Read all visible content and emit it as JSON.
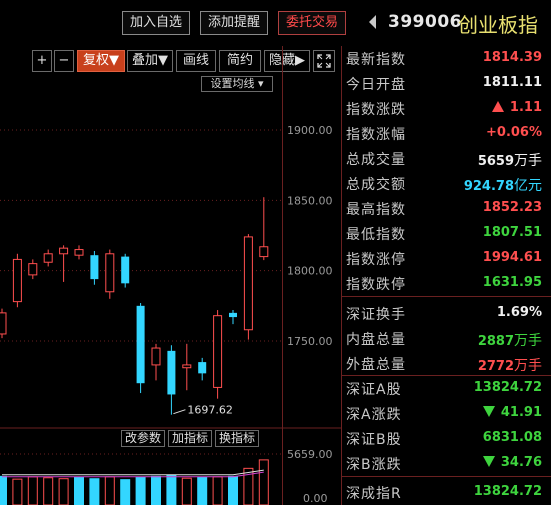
{
  "header": {
    "buttons": [
      "加入自选",
      "添加提醒",
      "委托交易"
    ],
    "code": "399006",
    "name": "创业板指"
  },
  "toolbar": {
    "plus": "+",
    "minus": "−",
    "fuquan": "复权▼",
    "overlay": "叠加▼",
    "draw": "画线",
    "simple": "简约",
    "hide": "隐藏▶",
    "fullscreen_icon": "expand-icon",
    "set_ma": "设置均线 ▾"
  },
  "chart_data": {
    "type": "candlestick",
    "y_ticks": [
      "1900.00",
      "1850.00",
      "1800.00",
      "1750.00"
    ],
    "ylim": [
      1680,
      1945
    ],
    "low_annotation": "1697.62",
    "candles": [
      {
        "o": 1755,
        "c": 1770,
        "h": 1773,
        "l": 1752
      },
      {
        "o": 1778,
        "c": 1808,
        "h": 1812,
        "l": 1774
      },
      {
        "o": 1797,
        "c": 1805,
        "h": 1808,
        "l": 1794
      },
      {
        "o": 1806,
        "c": 1812,
        "h": 1815,
        "l": 1803
      },
      {
        "o": 1812,
        "c": 1816,
        "h": 1818,
        "l": 1792
      },
      {
        "o": 1811,
        "c": 1815,
        "h": 1818,
        "l": 1808
      },
      {
        "o": 1811,
        "c": 1794,
        "h": 1814,
        "l": 1790
      },
      {
        "o": 1785,
        "c": 1812,
        "h": 1815,
        "l": 1780
      },
      {
        "o": 1810,
        "c": 1791,
        "h": 1812,
        "l": 1788
      },
      {
        "o": 1775,
        "c": 1720,
        "h": 1777,
        "l": 1713
      },
      {
        "o": 1733,
        "c": 1745,
        "h": 1748,
        "l": 1722
      },
      {
        "o": 1743,
        "c": 1712,
        "h": 1747,
        "l": 1697.62
      },
      {
        "o": 1731,
        "c": 1733,
        "h": 1748,
        "l": 1715
      },
      {
        "o": 1735,
        "c": 1727,
        "h": 1738,
        "l": 1722
      },
      {
        "o": 1717,
        "c": 1768,
        "h": 1772,
        "l": 1709
      },
      {
        "o": 1770,
        "c": 1767,
        "h": 1772,
        "l": 1762
      },
      {
        "o": 1758,
        "c": 1824,
        "h": 1826,
        "l": 1751
      },
      {
        "o": 1810,
        "c": 1817,
        "h": 1852.23,
        "l": 1807.51
      }
    ],
    "sub_buttons": [
      "改参数",
      "加指标",
      "换指标"
    ],
    "sub_y_ticks": [
      "5659.00",
      "0.00"
    ],
    "volume_colors": [
      "cyan",
      "red",
      "red",
      "red",
      "red",
      "cyan",
      "cyan",
      "red",
      "cyan",
      "cyan",
      "cyan",
      "cyan",
      "red",
      "cyan",
      "red",
      "cyan",
      "red",
      "red"
    ],
    "volume_levels": [
      0.62,
      0.55,
      0.6,
      0.58,
      0.56,
      0.6,
      0.57,
      0.6,
      0.55,
      0.6,
      0.62,
      0.64,
      0.57,
      0.6,
      0.6,
      0.62,
      0.78,
      0.96
    ]
  },
  "colors": {
    "up": "#ff4f4f",
    "down": "#33d6ff",
    "grid": "#6a2020"
  },
  "quote": {
    "rows": [
      {
        "label": "最新指数",
        "value": "1814.39",
        "color": "up"
      },
      {
        "label": "今日开盘",
        "value": "1811.11",
        "color": "white"
      },
      {
        "label": "指数涨跌",
        "value": "1.11",
        "color": "up",
        "arrow": "up"
      },
      {
        "label": "指数涨幅",
        "value": "+0.06%",
        "color": "up"
      },
      {
        "label": "总成交量",
        "value": "5659",
        "unit": "万手",
        "color": "white"
      },
      {
        "label": "总成交额",
        "value": "924.78",
        "unit": "亿元",
        "color": "cyan"
      },
      {
        "label": "最高指数",
        "value": "1852.23",
        "color": "up"
      },
      {
        "label": "最低指数",
        "value": "1807.51",
        "color": "down"
      },
      {
        "label": "指数涨停",
        "value": "1994.61",
        "color": "up"
      },
      {
        "label": "指数跌停",
        "value": "1631.95",
        "color": "down"
      },
      {
        "label": "深证换手",
        "value": "1.69%",
        "color": "white"
      },
      {
        "label": "内盘总量",
        "value": "2887",
        "unit": "万手",
        "color": "down"
      },
      {
        "label": "外盘总量",
        "value": "2772",
        "unit": "万手",
        "color": "up"
      },
      {
        "label": "深证A股",
        "value": "13824.72",
        "color": "down"
      },
      {
        "label": "深A涨跌",
        "value": "41.91",
        "color": "down",
        "arrow": "down"
      },
      {
        "label": "深证B股",
        "value": "6831.08",
        "color": "down"
      },
      {
        "label": "深B涨跌",
        "value": "34.76",
        "color": "down",
        "arrow": "down"
      },
      {
        "label": "深成指R",
        "value": "13824.72",
        "color": "down"
      }
    ]
  }
}
